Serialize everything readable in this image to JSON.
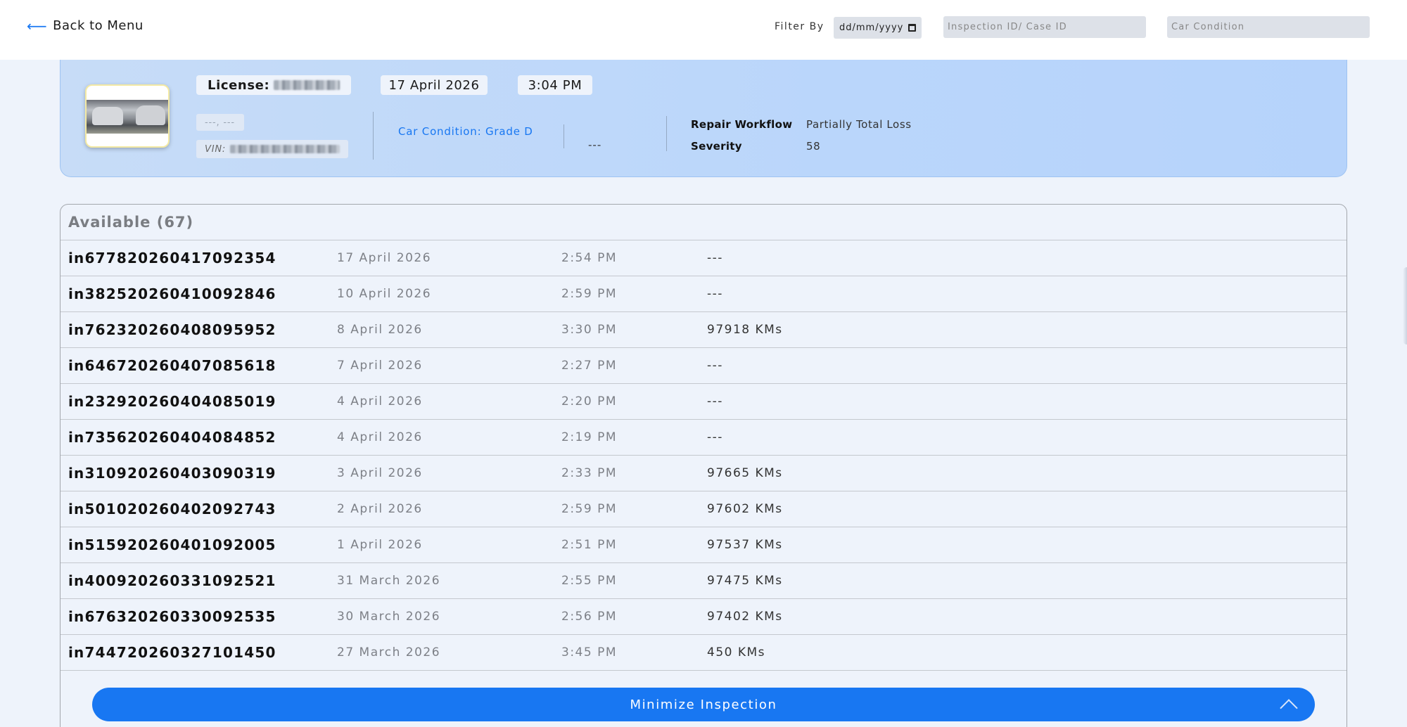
{
  "topbar": {
    "back_label": "Back to Menu",
    "filter_label": "Filter By",
    "date_placeholder": "dd/mm/yyyy",
    "case_placeholder": "Inspection ID/ Case ID",
    "condition_placeholder": "Car Condition"
  },
  "card": {
    "license_label": "License:",
    "date": "17 April 2026",
    "time": "3:04 PM",
    "location": "---, ---",
    "vin_label": "VIN:",
    "car_condition": "Car Condition: Grade D",
    "mileage": "---",
    "repair_workflow_label": "Repair Workflow",
    "repair_workflow_value": "Partially Total Loss",
    "severity_label": "Severity",
    "severity_value": "58"
  },
  "list": {
    "header": "Available (67)",
    "rows": [
      {
        "id": "in677820260417092354",
        "date": "17 April 2026",
        "time": "2:54 PM",
        "km": "---"
      },
      {
        "id": "in382520260410092846",
        "date": "10 April 2026",
        "time": "2:59 PM",
        "km": "---"
      },
      {
        "id": "in762320260408095952",
        "date": "8 April 2026",
        "time": "3:30 PM",
        "km": "97918 KMs"
      },
      {
        "id": "in646720260407085618",
        "date": "7 April 2026",
        "time": "2:27 PM",
        "km": "---"
      },
      {
        "id": "in232920260404085019",
        "date": "4 April 2026",
        "time": "2:20 PM",
        "km": "---"
      },
      {
        "id": "in735620260404084852",
        "date": "4 April 2026",
        "time": "2:19 PM",
        "km": "---"
      },
      {
        "id": "in310920260403090319",
        "date": "3 April 2026",
        "time": "2:33 PM",
        "km": "97665 KMs"
      },
      {
        "id": "in501020260402092743",
        "date": "2 April 2026",
        "time": "2:59 PM",
        "km": "97602 KMs"
      },
      {
        "id": "in515920260401092005",
        "date": "1 April 2026",
        "time": "2:51 PM",
        "km": "97537 KMs"
      },
      {
        "id": "in400920260331092521",
        "date": "31 March 2026",
        "time": "2:55 PM",
        "km": "97475 KMs"
      },
      {
        "id": "in676320260330092535",
        "date": "30 March 2026",
        "time": "2:56 PM",
        "km": "97402 KMs"
      },
      {
        "id": "in744720260327101450",
        "date": "27 March 2026",
        "time": "3:45 PM",
        "km": "450 KMs"
      }
    ]
  },
  "minimize_label": "Minimize Inspection",
  "colors": {
    "accent": "#1877f2",
    "card_bg": "#bad6fb",
    "page_bg": "#eef3fb"
  },
  "icons": {
    "back": "arrow-left-icon",
    "calendar": "calendar-icon",
    "chevron": "chevron-up-icon"
  }
}
